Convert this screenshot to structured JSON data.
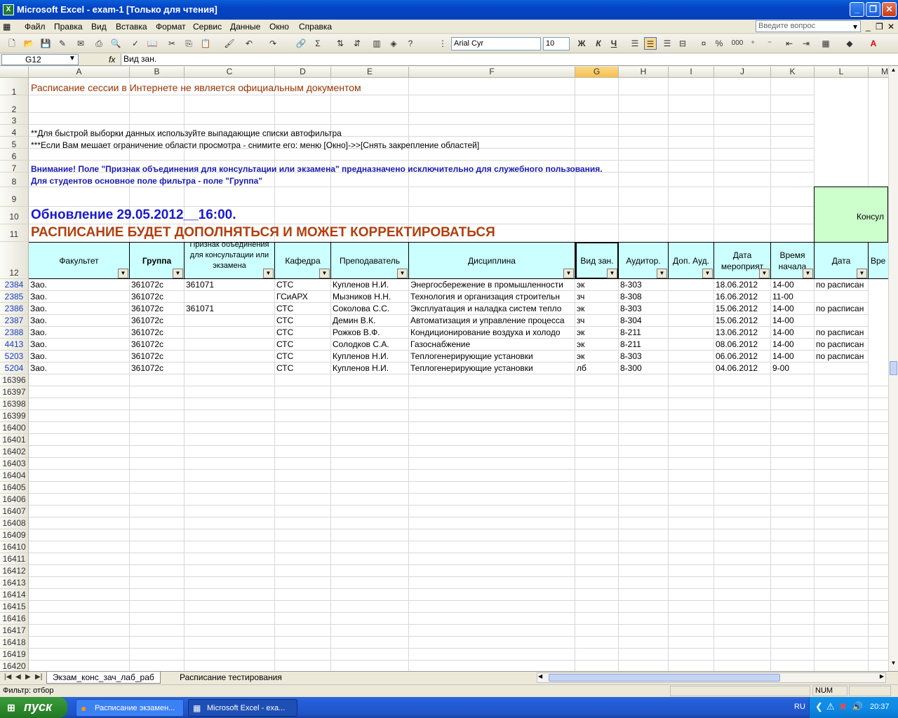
{
  "window": {
    "title": "Microsoft Excel - exam-1  [Только для чтения]",
    "app_icon": "excel-icon"
  },
  "menu": [
    "Файл",
    "Правка",
    "Вид",
    "Вставка",
    "Формат",
    "Сервис",
    "Данные",
    "Окно",
    "Справка"
  ],
  "ask_placeholder": "Введите вопрос",
  "toolbar": {
    "font": "Arial Cyr",
    "size": "10",
    "bold": "Ж",
    "italic": "К",
    "underline": "Ч",
    "percent": "%",
    "thousands": "000"
  },
  "formula_bar": {
    "name_box": "G12",
    "fx": "fx",
    "content": "Вид зан."
  },
  "columns": [
    "A",
    "B",
    "C",
    "D",
    "E",
    "F",
    "G",
    "H",
    "I",
    "J",
    "K",
    "L",
    "M"
  ],
  "notes": {
    "r1": "Расписание сессии в Интернете не является официальным документом",
    "r4": "**Для быстрой выборки данных используйте выпадающие списки автофильтра",
    "r5": "***Если Вам мешает ограничение области просмотра - снимите его: меню [Окно]->>[Снять закрепление областей]",
    "r7": "Внимание! Поле \"Признак объединения для консультации или экзамена\" предназначено исключительно для служебного пользования.",
    "r8": "Для студентов основное поле фильтра - поле \"Группа\"",
    "r10": "Обновление 29.05.2012__16:00.",
    "r11": "РАСПИСАНИЕ БУДЕТ ДОПОЛНЯТЬСЯ И МОЖЕТ КОРРЕКТИРОВАТЬСЯ",
    "consult": "Консул"
  },
  "top_rows": [
    "1",
    "2",
    "3",
    "4",
    "5",
    "6",
    "7",
    "8",
    "9",
    "10",
    "11",
    "12"
  ],
  "headers": {
    "A": "Факультет",
    "B": "Группа",
    "C": "Признак объединения для консультации или экзамена",
    "D": "Кафедра",
    "E": "Преподаватель",
    "F": "Дисциплина",
    "G": "Вид зан.",
    "H": "Аудитор.",
    "I": "Доп. Ауд.",
    "J": "Дата мероприят",
    "K": "Время начала",
    "L": "Дата",
    "M": "Вре"
  },
  "rows": [
    {
      "n": "2384",
      "a": "Зао.",
      "b": "361072с",
      "c": "361071",
      "d": "СТС",
      "e": "Купленов Н.И.",
      "f": "Энергосбережение в промышленности",
      "g": "эк",
      "h": "8-303",
      "i": "",
      "j": "18.06.2012",
      "k": "14-00",
      "l": "по расписан"
    },
    {
      "n": "2385",
      "a": "Зао.",
      "b": "361072с",
      "c": "",
      "d": "ГСиАРХ",
      "e": "Мызников Н.Н.",
      "f": "Технология и организация строительн",
      "g": "зч",
      "h": "8-308",
      "i": "",
      "j": "16.06.2012",
      "k": "11-00",
      "l": ""
    },
    {
      "n": "2386",
      "a": "Зао.",
      "b": "361072с",
      "c": "361071",
      "d": "СТС",
      "e": "Соколова С.С.",
      "f": "Эксплуатация и наладка систем тепло",
      "g": "эк",
      "h": "8-303",
      "i": "",
      "j": "15.06.2012",
      "k": "14-00",
      "l": "по расписан"
    },
    {
      "n": "2387",
      "a": "Зао.",
      "b": "361072с",
      "c": "",
      "d": "СТС",
      "e": "Демин В.К.",
      "f": "Автоматизация и управление процесса",
      "g": "зч",
      "h": "8-304",
      "i": "",
      "j": "15.06.2012",
      "k": "14-00",
      "l": ""
    },
    {
      "n": "2388",
      "a": "Зао.",
      "b": "361072с",
      "c": "",
      "d": "СТС",
      "e": "Рожков В.Ф.",
      "f": "Кондиционирование воздуха и холодо",
      "g": "эк",
      "h": "8-211",
      "i": "",
      "j": "13.06.2012",
      "k": "14-00",
      "l": "по расписан"
    },
    {
      "n": "4413",
      "a": "Зао.",
      "b": "361072с",
      "c": "",
      "d": "СТС",
      "e": "Солодков С.А.",
      "f": "Газоснабжение",
      "g": "эк",
      "h": "8-211",
      "i": "",
      "j": "08.06.2012",
      "k": "14-00",
      "l": "по расписан"
    },
    {
      "n": "5203",
      "a": "Зао.",
      "b": "361072с",
      "c": "",
      "d": "СТС",
      "e": "Купленов Н.И.",
      "f": "Теплогенерирующие установки",
      "g": "эк",
      "h": "8-303",
      "i": "",
      "j": "06.06.2012",
      "k": "14-00",
      "l": "по расписан"
    },
    {
      "n": "5204",
      "a": "Зао.",
      "b": "361072с",
      "c": "",
      "d": "СТС",
      "e": "Купленов Н.И.",
      "f": "Теплогенерирующие установки",
      "g": "лб",
      "h": "8-300",
      "i": "",
      "j": "04.06.2012",
      "k": "9-00",
      "l": ""
    }
  ],
  "empty_rows": [
    "16396",
    "16397",
    "16398",
    "16399",
    "16400",
    "16401",
    "16402",
    "16403",
    "16404",
    "16405",
    "16406",
    "16407",
    "16408",
    "16409",
    "16410",
    "16411",
    "16412",
    "16413",
    "16414",
    "16415",
    "16416",
    "16417",
    "16418",
    "16419",
    "16420"
  ],
  "sheets": [
    "Экзам_конс_зач_лаб_раб",
    "Расписание тестирования"
  ],
  "status": {
    "left": "Фильтр: отбор",
    "num": "NUM"
  },
  "taskbar": {
    "start": "пуск",
    "items": [
      "Расписание экзамен...",
      "Microsoft Excel - exa..."
    ],
    "lang": "RU",
    "clock": "20:37"
  }
}
